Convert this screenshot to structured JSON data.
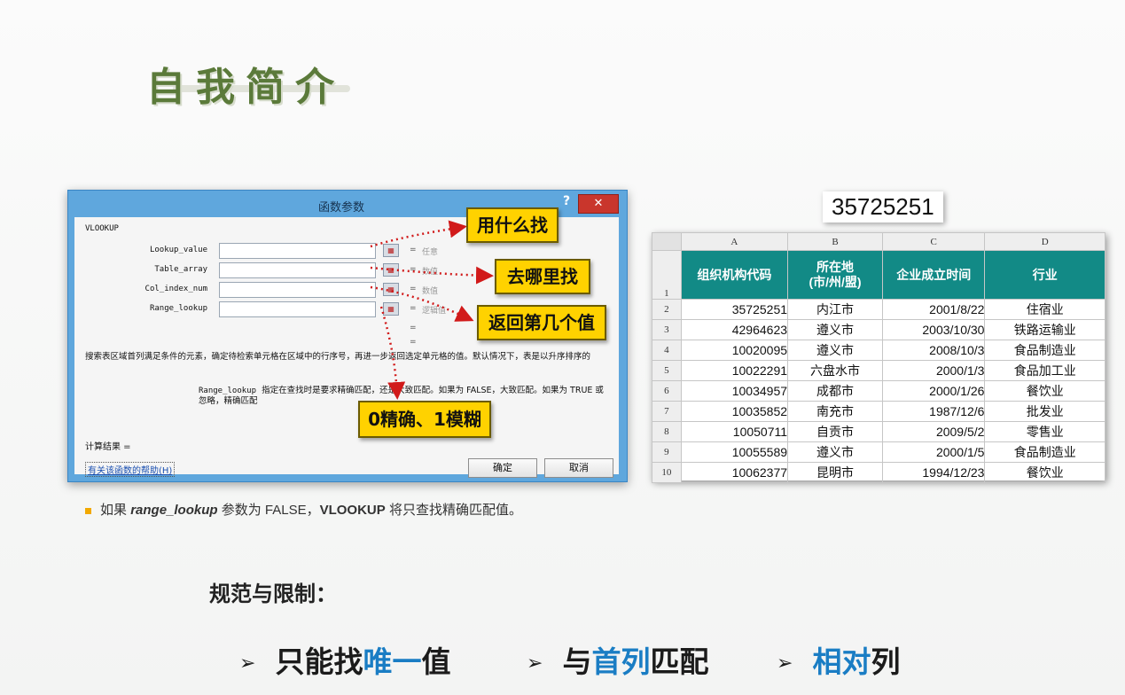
{
  "slide": {
    "title": "自我简介"
  },
  "dialog": {
    "title": "函数参数",
    "help": "?",
    "close": "✕",
    "function_name": "VLOOKUP",
    "args": [
      {
        "label": "Lookup_value",
        "hint": "任意"
      },
      {
        "label": "Table_array",
        "hint": "数值"
      },
      {
        "label": "Col_index_num",
        "hint": "数值"
      },
      {
        "label": "Range_lookup",
        "hint": "逻辑值"
      }
    ],
    "eq": "=",
    "description": "搜索表区域首列满足条件的元素，确定待检索单元格在区域中的行序号，再进一步返回选定单元格的值。默认情况下，表是以升序排序的",
    "range_lookup_label": "Range_lookup",
    "range_lookup_desc": "指定在查找时是要求精确匹配，还是大致匹配。如果为 FALSE，大致匹配。如果为 TRUE 或忽略，精确匹配",
    "calc_result": "计算结果 =",
    "help_link": "有关该函数的帮助(H)",
    "ok": "确定",
    "cancel": "取消"
  },
  "callouts": {
    "what": "用什么找",
    "where": "去哪里找",
    "which_col": "返回第几个值",
    "match": "0精确、1模糊"
  },
  "lookup_value": "35725251",
  "sheet": {
    "columns": [
      "A",
      "B",
      "C",
      "D"
    ],
    "header_row_num": "1",
    "headers": [
      "组织机构代码",
      "所在地\n(市/州/盟)",
      "企业成立时间",
      "行业"
    ],
    "rows": [
      {
        "n": "2",
        "code": "35725251",
        "city": "内江市",
        "date": "2001/8/22",
        "industry": "住宿业"
      },
      {
        "n": "3",
        "code": "42964623",
        "city": "遵义市",
        "date": "2003/10/30",
        "industry": "铁路运输业"
      },
      {
        "n": "4",
        "code": "10020095",
        "city": "遵义市",
        "date": "2008/10/3",
        "industry": "食品制造业"
      },
      {
        "n": "5",
        "code": "10022291",
        "city": "六盘水市",
        "date": "2000/1/3",
        "industry": "食品加工业"
      },
      {
        "n": "6",
        "code": "10034957",
        "city": "成都市",
        "date": "2000/1/26",
        "industry": "餐饮业"
      },
      {
        "n": "7",
        "code": "10035852",
        "city": "南充市",
        "date": "1987/12/6",
        "industry": "批发业"
      },
      {
        "n": "8",
        "code": "10050711",
        "city": "自贡市",
        "date": "2009/5/2",
        "industry": "零售业"
      },
      {
        "n": "9",
        "code": "10055589",
        "city": "遵义市",
        "date": "2000/1/5",
        "industry": "食品制造业"
      },
      {
        "n": "10",
        "code": "10062377",
        "city": "昆明市",
        "date": "1994/12/23",
        "industry": "餐饮业"
      }
    ]
  },
  "note": {
    "prefix": "如果",
    "param": "range_lookup",
    "middle": "参数为 FALSE，",
    "func": "VLOOKUP",
    "suffix": "将只查找精确匹配值。"
  },
  "rules": {
    "heading": "规范与限制：",
    "items": [
      {
        "pre": "只能找",
        "hl": "唯一",
        "post": "值"
      },
      {
        "pre": "与",
        "hl": "首列",
        "post": "匹配"
      },
      {
        "pre": "",
        "hl": "相对",
        "post": "列"
      }
    ],
    "arrow": "➢"
  },
  "colors": {
    "title_green": "#5b7a3a",
    "callout_yellow": "#ffd200",
    "header_teal": "#128a86",
    "highlight_blue": "#1a7dc4",
    "arrow_red": "#d11a1a"
  }
}
